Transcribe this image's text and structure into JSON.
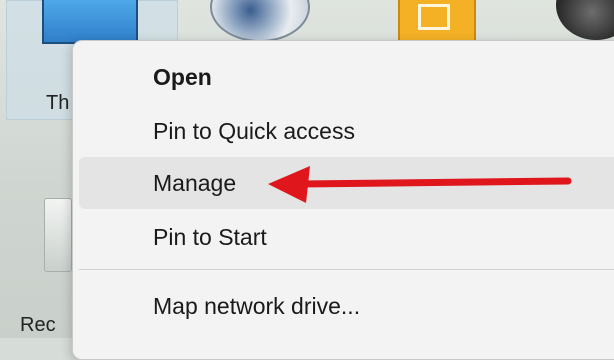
{
  "desktop": {
    "this_pc_label": "Th",
    "recycle_label": "Rec"
  },
  "context_menu": {
    "items": [
      {
        "label": "Open",
        "bold": true
      },
      {
        "label": "Pin to Quick access"
      },
      {
        "label": "Manage",
        "highlighted": true
      },
      {
        "label": "Pin to Start"
      },
      {
        "label": "Map network drive..."
      }
    ]
  },
  "annotation": {
    "arrow_color": "#e0161d",
    "points_to": "Manage"
  }
}
